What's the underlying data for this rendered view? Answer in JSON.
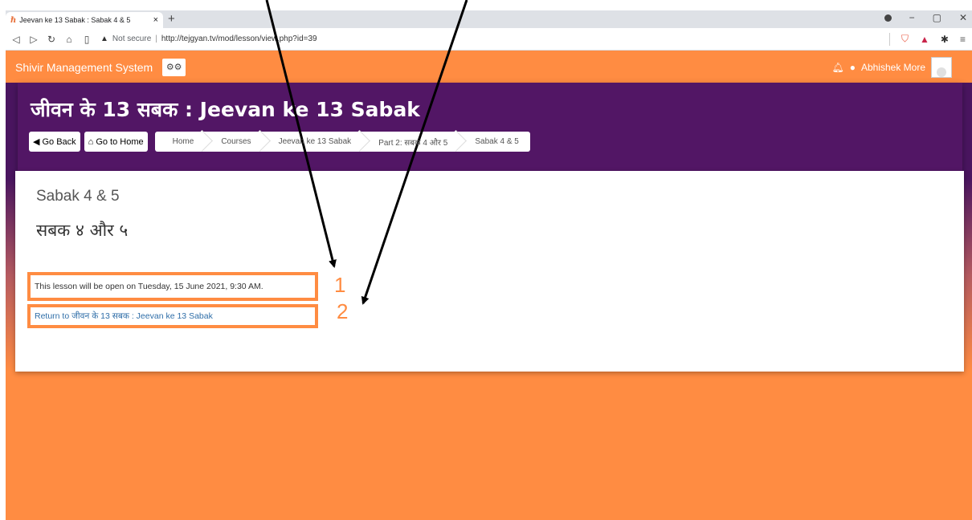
{
  "browser": {
    "tab_title": "Jeevan ke 13 Sabak : Sabak 4 & 5",
    "favicon_glyph": "ℏ",
    "close_glyph": "×",
    "newtab_glyph": "+",
    "security_label": "Not secure",
    "url": "http://tejgyan.tv/mod/lesson/view.php?id=39",
    "icons": [
      "back-icon",
      "forward-icon",
      "reload-icon",
      "home-icon",
      "bookmark-icon",
      "warning-icon",
      "brave-shield-icon",
      "brave-rewards-icon",
      "extensions-icon",
      "menu-icon"
    ]
  },
  "site": {
    "name": "Shivir Management System",
    "user_name": "Abhishek More"
  },
  "heading": {
    "title": "जीवन के 13 सबक : Jeevan ke 13 Sabak",
    "go_back": "Go Back",
    "go_home": "Go to Home"
  },
  "breadcrumb": [
    "Home",
    "Courses",
    "Jeevan ke 13 Sabak",
    "Part 2: सबक 4 और 5",
    "Sabak 4 & 5"
  ],
  "main": {
    "lesson_title": "Sabak 4 & 5",
    "lesson_subtitle": "सबक ४ और ५",
    "notice": "This lesson will be open on Tuesday, 15 June 2021, 9:30 AM.",
    "return_link": "Return to जीवन के 13 सबक : Jeevan ke 13 Sabak"
  },
  "annotations": {
    "label_1": "1",
    "label_2": "2",
    "highlight_color": "#ff8c42"
  },
  "colors": {
    "brand_orange": "#ff8c42",
    "header_purple": "#521665",
    "link_blue": "#2f6ea8"
  }
}
